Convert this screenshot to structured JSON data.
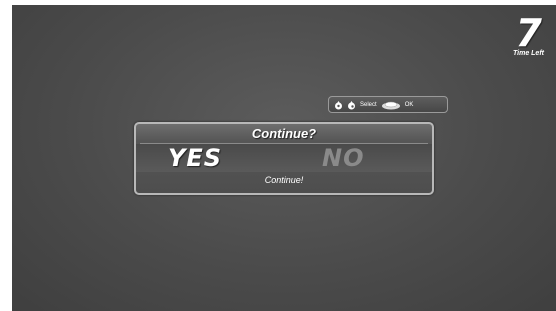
{
  "timer": {
    "value": "7",
    "label": "Time Left"
  },
  "controls_hint": {
    "icons": [
      "control-stick-left-icon",
      "control-stick-right-icon",
      "remote-button-icon"
    ],
    "select_label": "Select",
    "ok_label": "OK"
  },
  "dialog": {
    "title": "Continue?",
    "options": [
      {
        "label": "YES",
        "selected": true
      },
      {
        "label": "NO",
        "selected": false
      }
    ],
    "description": "Continue!"
  },
  "colors": {
    "background": "#4b4b4b",
    "selected_option": "#ffffff",
    "unselected_option": "#8a8a8a"
  }
}
